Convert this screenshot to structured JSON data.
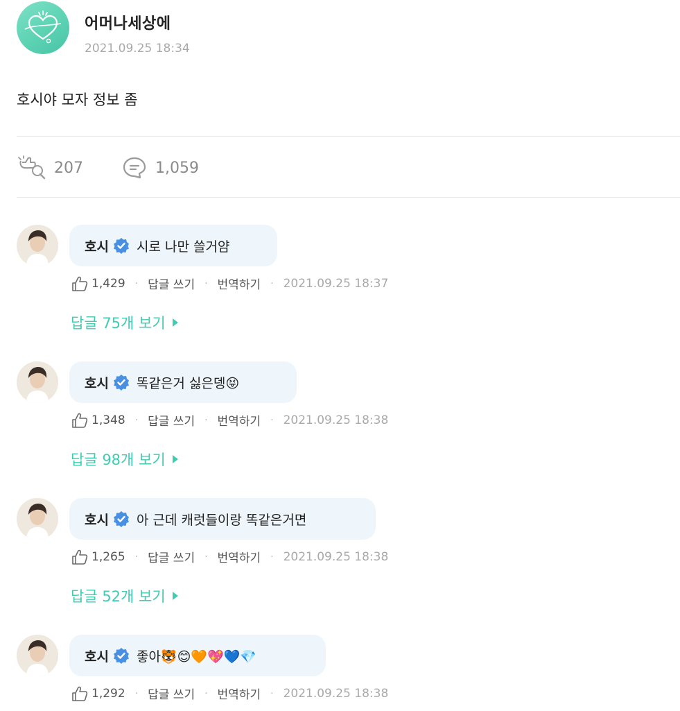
{
  "post": {
    "author": "어머나세상에",
    "date": "2021.09.25 18:34",
    "text": "호시야 모자 정보 좀",
    "likes": "207",
    "comments": "1,059"
  },
  "comments": [
    {
      "name": "호시",
      "text": "시로 나만 쓸거얌",
      "likes": "1,429",
      "reply_label": "답글 쓰기",
      "translate_label": "번역하기",
      "date": "2021.09.25 18:37",
      "replies": "답글 75개 보기"
    },
    {
      "name": "호시",
      "text": "똑같은거 싫은뎅😝",
      "likes": "1,348",
      "reply_label": "답글 쓰기",
      "translate_label": "번역하기",
      "date": "2021.09.25 18:38",
      "replies": "답글 98개 보기"
    },
    {
      "name": "호시",
      "text": "아 근데 캐럿들이랑 똑같은거면",
      "likes": "1,265",
      "reply_label": "답글 쓰기",
      "translate_label": "번역하기",
      "date": "2021.09.25 18:38",
      "replies": "답글 52개 보기"
    },
    {
      "name": "호시",
      "text": "좋아🐯😊🧡💖💙💎",
      "likes": "1,292",
      "reply_label": "답글 쓰기",
      "translate_label": "번역하기",
      "date": "2021.09.25 18:38"
    }
  ],
  "colors": {
    "accent": "#3fcdb2",
    "bubble": "#eef6fb",
    "verified": "#4a90e2",
    "muted": "#a9a9a9"
  },
  "icons": {
    "post_avatar": "heart-sparkle-logo-icon",
    "likes": "bulb-hand-icon",
    "comments": "speech-bubble-icon",
    "verified": "verified-badge-icon",
    "like": "thumbs-up-icon",
    "expand": "triangle-right-icon"
  }
}
